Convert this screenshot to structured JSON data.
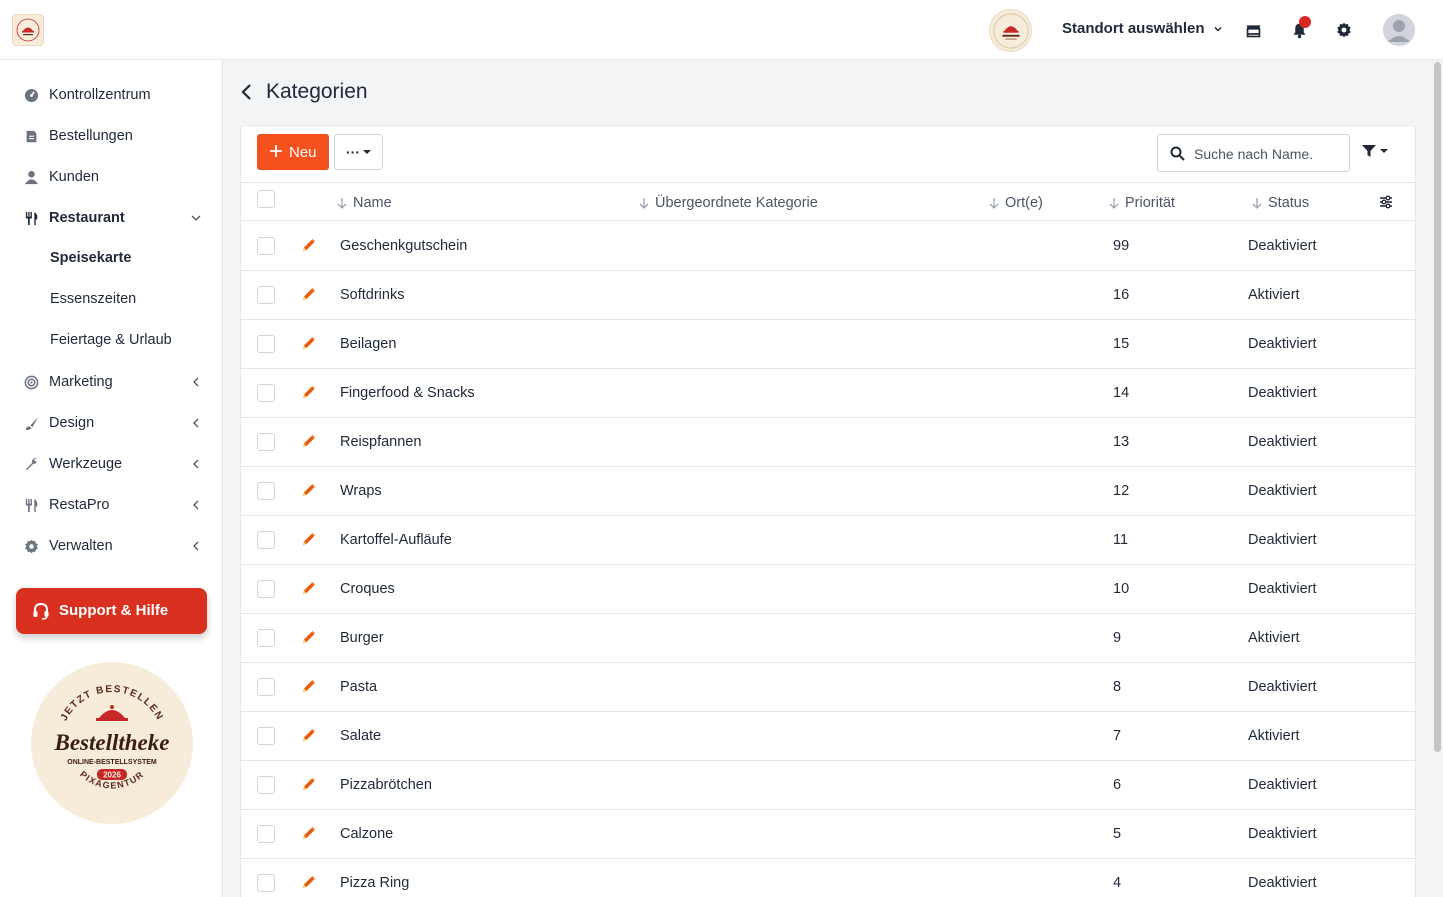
{
  "header": {
    "location_selector": "Standort auswählen"
  },
  "sidebar": {
    "items": [
      {
        "label": "Kontrollzentrum",
        "icon": "dashboard-icon"
      },
      {
        "label": "Bestellungen",
        "icon": "receipt-icon"
      },
      {
        "label": "Kunden",
        "icon": "user-icon"
      },
      {
        "label": "Restaurant",
        "icon": "utensils-icon"
      },
      {
        "label": "Marketing",
        "icon": "target-icon"
      },
      {
        "label": "Design",
        "icon": "brush-icon"
      },
      {
        "label": "Werkzeuge",
        "icon": "wrench-icon"
      },
      {
        "label": "RestaPro",
        "icon": "utensils-icon"
      },
      {
        "label": "Verwalten",
        "icon": "gear-icon"
      }
    ],
    "sub_items": [
      "Speisekarte",
      "Essenszeiten",
      "Feiertage & Urlaub"
    ],
    "support_label": "Support & Hilfe"
  },
  "page": {
    "title": "Kategorien"
  },
  "toolbar": {
    "new_label": "Neu",
    "more_label": "···",
    "search_placeholder": "Suche nach Name."
  },
  "table": {
    "columns": [
      "Name",
      "Übergeordnete Kategorie",
      "Ort(e)",
      "Priorität",
      "Status"
    ],
    "rows": [
      {
        "name": "Geschenkgutschein",
        "priority": "99",
        "status": "Deaktiviert"
      },
      {
        "name": "Softdrinks",
        "priority": "16",
        "status": "Aktiviert"
      },
      {
        "name": "Beilagen",
        "priority": "15",
        "status": "Deaktiviert"
      },
      {
        "name": "Fingerfood & Snacks",
        "priority": "14",
        "status": "Deaktiviert"
      },
      {
        "name": "Reispfannen",
        "priority": "13",
        "status": "Deaktiviert"
      },
      {
        "name": "Wraps",
        "priority": "12",
        "status": "Deaktiviert"
      },
      {
        "name": "Kartoffel-Aufläufe",
        "priority": "11",
        "status": "Deaktiviert"
      },
      {
        "name": "Croques",
        "priority": "10",
        "status": "Deaktiviert"
      },
      {
        "name": "Burger",
        "priority": "9",
        "status": "Aktiviert"
      },
      {
        "name": "Pasta",
        "priority": "8",
        "status": "Deaktiviert"
      },
      {
        "name": "Salate",
        "priority": "7",
        "status": "Aktiviert"
      },
      {
        "name": "Pizzabrötchen",
        "priority": "6",
        "status": "Deaktiviert"
      },
      {
        "name": "Calzone",
        "priority": "5",
        "status": "Deaktiviert"
      },
      {
        "name": "Pizza Ring",
        "priority": "4",
        "status": "Deaktiviert"
      }
    ]
  },
  "badge": {
    "top_text": "JETZT BESTELLEN",
    "brand": "Bestelltheke",
    "subtitle": "ONLINE-BESTELLSYSTEM",
    "year": "2026",
    "bottom_text": "PIXAGENTUR"
  },
  "colors": {
    "accent": "#f4511e",
    "support": "#d9301f",
    "brand_red": "#c62828",
    "badge_bg": "#f6ecd9"
  }
}
